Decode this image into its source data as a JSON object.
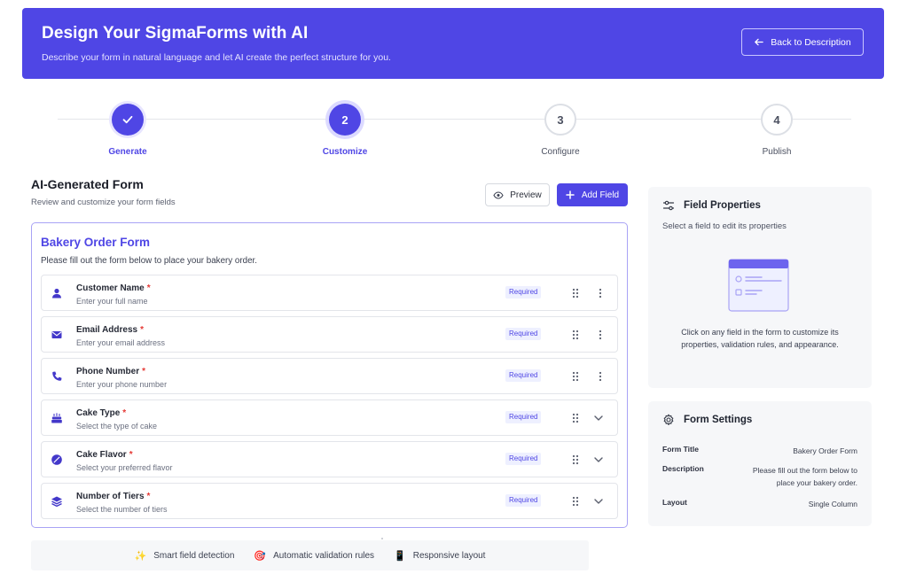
{
  "banner": {
    "title": "Design Your SigmaForms with AI",
    "subtitle": "Describe your form in natural language and let AI create the perfect structure for you.",
    "back_label": "Back to Description"
  },
  "steps": [
    {
      "number": "1",
      "label": "Generate",
      "state": "done"
    },
    {
      "number": "2",
      "label": "Customize",
      "state": "active"
    },
    {
      "number": "3",
      "label": "Configure",
      "state": "pending"
    },
    {
      "number": "4",
      "label": "Publish",
      "state": "pending"
    }
  ],
  "section": {
    "title": "AI-Generated Form",
    "subtitle": "Review and customize your form fields",
    "preview_label": "Preview",
    "add_field_label": "Add Field"
  },
  "form": {
    "title": "Bakery Order Form",
    "description": "Please fill out the form below to place your bakery order.",
    "fields": [
      {
        "label": "Customer Name",
        "placeholder": "Enter your full name",
        "badge": "Required",
        "icon": "user-icon",
        "action": "more"
      },
      {
        "label": "Email Address",
        "placeholder": "Enter your email address",
        "badge": "Required",
        "icon": "mail-icon",
        "action": "more"
      },
      {
        "label": "Phone Number",
        "placeholder": "Enter your phone number",
        "badge": "Required",
        "icon": "phone-icon",
        "action": "more"
      },
      {
        "label": "Cake Type",
        "placeholder": "Select the type of cake",
        "badge": "Required",
        "icon": "cake-icon",
        "action": "chevron"
      },
      {
        "label": "Cake Flavor",
        "placeholder": "Select your preferred flavor",
        "badge": "Required",
        "icon": "flavor-icon",
        "action": "chevron"
      },
      {
        "label": "Number of Tiers",
        "placeholder": "Select the number of tiers",
        "badge": "Required",
        "icon": "layers-icon",
        "action": "chevron"
      }
    ]
  },
  "footer": {
    "items": [
      {
        "icon": "✨",
        "label": "Smart field detection"
      },
      {
        "icon": "🎯",
        "label": "Automatic validation rules"
      },
      {
        "icon": "📱",
        "label": "Responsive layout"
      }
    ]
  },
  "properties_panel": {
    "title": "Field Properties",
    "subtitle": "Select a field to edit its properties",
    "note": "Click on any field in the form to customize its properties, validation rules, and appearance."
  },
  "settings_panel": {
    "title": "Form Settings",
    "rows": [
      {
        "key": "Form Title",
        "value": "Bakery Order Form"
      },
      {
        "key": "Description",
        "value": "Please fill out the form below to place your bakery order."
      },
      {
        "key": "Layout",
        "value": "Single Column"
      }
    ]
  },
  "colors": {
    "accent": "#4f46e5",
    "required_star": "#e53935"
  }
}
